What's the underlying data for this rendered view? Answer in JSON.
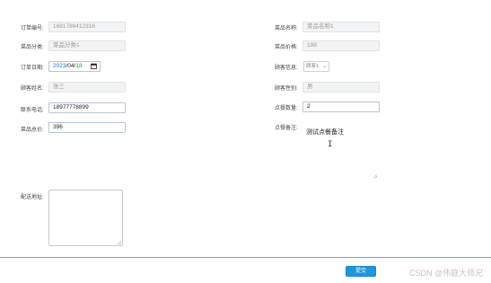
{
  "form": {
    "order_no": {
      "label": "订单编号:",
      "value": "1681786412316"
    },
    "dish_name": {
      "label": "菜品名称:",
      "value": "菜品名称1"
    },
    "dish_category": {
      "label": "菜品分类:",
      "value": "菜品分类1"
    },
    "dish_price": {
      "label": "菜品价格:",
      "value": "198"
    },
    "order_date": {
      "label": "订单日期:",
      "year": "2023",
      "sep1": "/",
      "month": "04",
      "sep2": "/",
      "day": "18"
    },
    "customer_info": {
      "label": "顾客信息:",
      "value": "顾客1",
      "caret": "⌄"
    },
    "customer_name": {
      "label": "顾客姓名:",
      "value": "张三"
    },
    "customer_gender": {
      "label": "顾客性别:",
      "value": "男"
    },
    "phone": {
      "label": "联系电话:",
      "value": "18977778899"
    },
    "quantity": {
      "label": "点餐数量:",
      "value": "2"
    },
    "total_price": {
      "label": "菜品总价:",
      "value": "396"
    },
    "remark": {
      "label": "点餐备注:",
      "value": "测试点餐备注"
    },
    "address": {
      "label": "配送地址:",
      "value": ""
    }
  },
  "submit_label": "提交",
  "watermark": "CSDN @伟庭大师兄",
  "cursor_glyph": "I",
  "colors": {
    "accent": "#1e96e0",
    "divider": "#35b7e6",
    "readonly_bg": "#f2f3f5"
  },
  "icons": [
    "calendar-icon",
    "chevron-down-icon",
    "text-cursor-icon",
    "resize-handle-icon"
  ]
}
